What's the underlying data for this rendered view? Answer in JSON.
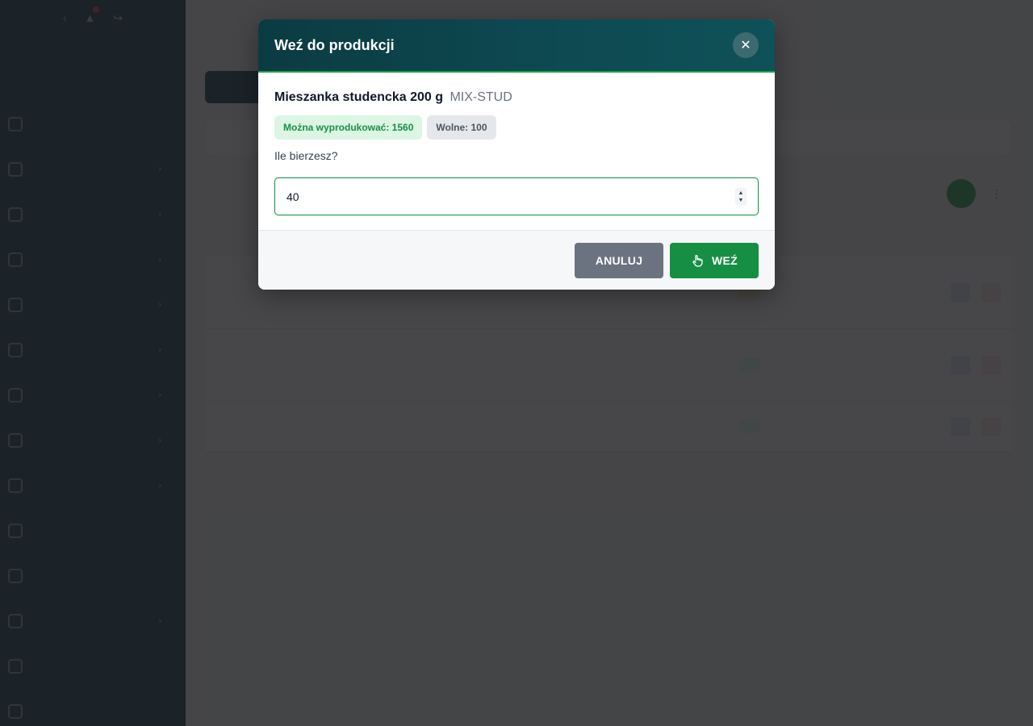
{
  "modal": {
    "title": "Weź do produkcji",
    "product_name": "Mieszanka studencka 200 g",
    "product_sku": "MIX-STUD",
    "badge_can_produce": "Można wyprodukować: 1560",
    "badge_free": "Wolne: 100",
    "qty_label": "Ile bierzesz?",
    "qty_value": "40",
    "cancel_label": "ANULUJ",
    "take_label": "WEŹ",
    "close_icon": "close-icon",
    "take_icon": "hand-pointer-icon",
    "colors": {
      "header": "#0b3b42",
      "accent": "#168f45",
      "cancel": "#6b7280"
    }
  }
}
